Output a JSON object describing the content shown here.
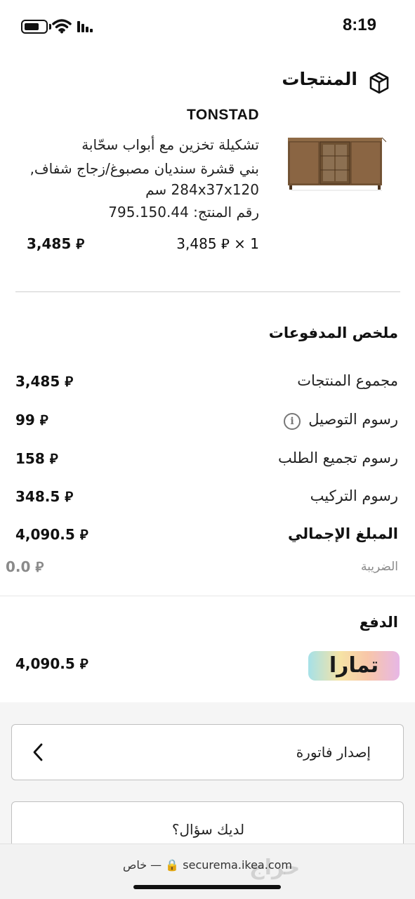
{
  "status_bar": {
    "time": "8:19"
  },
  "products": {
    "title": "المنتجات",
    "name": "TONSTAD",
    "description_line1": "تشكيلة تخزين مع أبواب سحّابة",
    "description_line2": "بني قشرة سنديان مصبوغ/زجاج شفاف,",
    "description_line3": "284x37x120 سم",
    "article_number": "رقم المنتج: 795.150.44",
    "unit_price_line": "3,485 ⃁ × 1",
    "line_total": "3,485 ⃁"
  },
  "summary": {
    "title": "ملخص المدفوعات",
    "rows": [
      {
        "label": "مجموع المنتجات",
        "value": "3,485 ⃁"
      },
      {
        "label": "رسوم التوصيل",
        "value": "99 ⃁"
      },
      {
        "label": "رسوم تجميع الطلب",
        "value": "158 ⃁"
      },
      {
        "label": "رسوم التركيب",
        "value": "348.5 ⃁"
      },
      {
        "label": "المبلغ الإجمالي",
        "value": "4,090.5 ⃁"
      },
      {
        "label": "الضريبة",
        "value": "0.0 ⃁"
      }
    ]
  },
  "payment": {
    "title": "الدفع",
    "provider_logo_text": "تمارا",
    "amount": "4,090.5 ⃁"
  },
  "actions": {
    "invoice_label": "إصدار فاتورة",
    "question_label": "لديك سؤال؟"
  },
  "browser": {
    "url": "securema.ikea.com 🔒 — خاص"
  },
  "watermark": "حراج",
  "colors": {
    "divider": "#cfcfcf",
    "muted_text": "#8a8a8a",
    "grey_background": "#f5f5f5"
  },
  "icons": [
    "battery-icon",
    "wifi-icon",
    "signal-icon",
    "box-icon",
    "info-icon",
    "chevron-left-icon",
    "lock-icon"
  ]
}
